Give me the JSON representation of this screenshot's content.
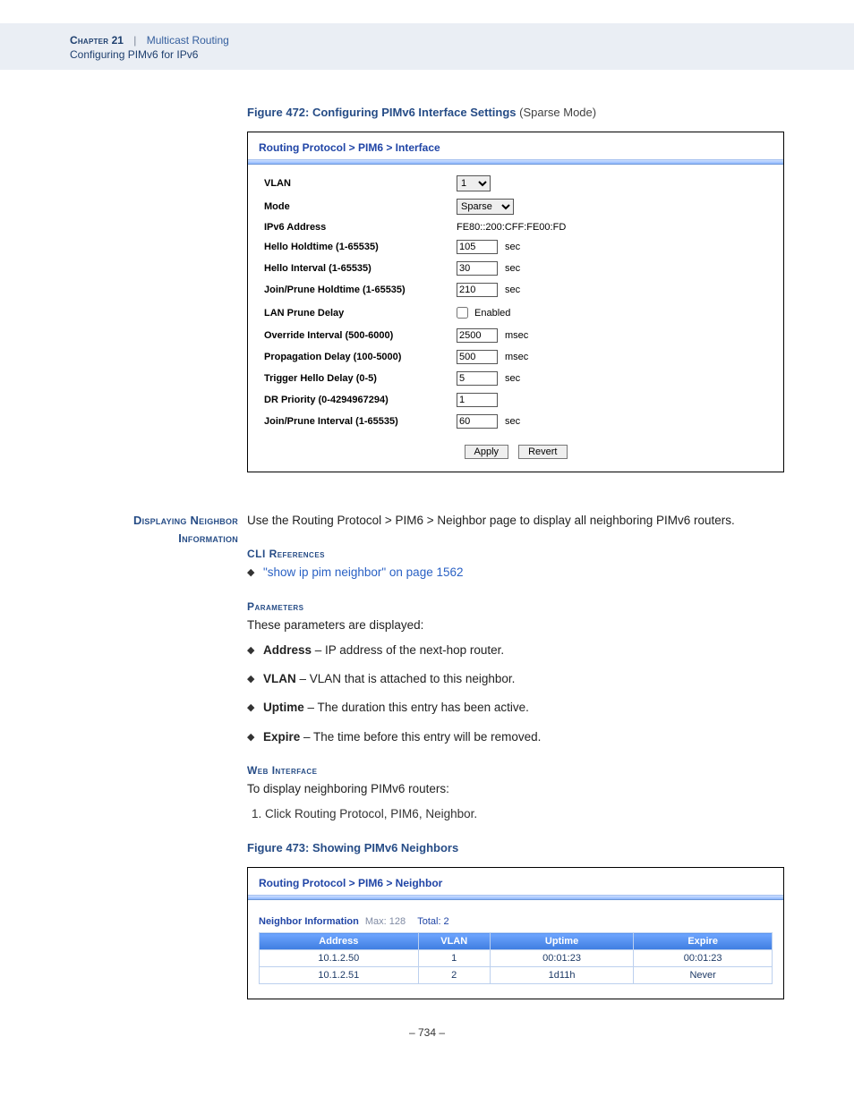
{
  "header": {
    "chapter_label": "Chapter",
    "chapter_num": "21",
    "separator": "|",
    "title": "Multicast Routing",
    "subtitle": "Configuring PIMv6 for IPv6"
  },
  "figure472": {
    "prefix": "Figure 472:  ",
    "title": "Configuring PIMv6 Interface Settings",
    "mode": " (Sparse Mode)",
    "breadcrumb": "Routing Protocol > PIM6 > Interface",
    "rows": {
      "vlan": {
        "label": "VLAN",
        "value": "1"
      },
      "mode": {
        "label": "Mode",
        "value": "Sparse"
      },
      "ipv6": {
        "label": "IPv6 Address",
        "value": "FE80::200:CFF:FE00:FD"
      },
      "hello_hold": {
        "label": "Hello Holdtime (1-65535)",
        "value": "105",
        "unit": "sec"
      },
      "hello_int": {
        "label": "Hello Interval (1-65535)",
        "value": "30",
        "unit": "sec"
      },
      "jp_hold": {
        "label": "Join/Prune Holdtime (1-65535)",
        "value": "210",
        "unit": "sec"
      },
      "lan_delay": {
        "label": "LAN Prune Delay",
        "text": "Enabled"
      },
      "override": {
        "label": "Override Interval (500-6000)",
        "value": "2500",
        "unit": "msec"
      },
      "prop": {
        "label": "Propagation Delay (100-5000)",
        "value": "500",
        "unit": "msec"
      },
      "trig": {
        "label": "Trigger Hello Delay (0-5)",
        "value": "5",
        "unit": "sec"
      },
      "dr": {
        "label": "DR Priority (0-4294967294)",
        "value": "1"
      },
      "jp_int": {
        "label": "Join/Prune Interval (1-65535)",
        "value": "60",
        "unit": "sec"
      }
    },
    "buttons": {
      "apply": "Apply",
      "revert": "Revert"
    }
  },
  "section": {
    "side_line1": "Displaying Neighbor",
    "side_line2": "Information",
    "intro": "Use the Routing Protocol > PIM6 > Neighbor page to display all neighboring PIMv6 routers.",
    "cli_head": "CLI References",
    "cli_link": "\"show ip pim neighbor\" on page 1562",
    "param_head": "Parameters",
    "param_intro": "These parameters are displayed:",
    "params": [
      {
        "name": "Address",
        "desc": " – IP address of the next-hop router."
      },
      {
        "name": "VLAN",
        "desc": " – VLAN that is attached to this neighbor."
      },
      {
        "name": "Uptime",
        "desc": " – The duration this entry has been active."
      },
      {
        "name": "Expire",
        "desc": " – The time before this entry will be removed."
      }
    ],
    "web_head": "Web Interface",
    "web_intro": "To display neighboring PIMv6 routers:",
    "step1": "Click Routing Protocol, PIM6, Neighbor."
  },
  "figure473": {
    "prefix": "Figure 473:  ",
    "title": "Showing PIMv6 Neighbors",
    "breadcrumb": "Routing Protocol > PIM6 > Neighbor",
    "info_label": "Neighbor Information",
    "info_max": "Max: 128",
    "info_total": "Total: 2",
    "columns": {
      "addr": "Address",
      "vlan": "VLAN",
      "uptime": "Uptime",
      "expire": "Expire"
    },
    "rows": [
      {
        "addr": "10.1.2.50",
        "vlan": "1",
        "uptime": "00:01:23",
        "expire": "00:01:23"
      },
      {
        "addr": "10.1.2.51",
        "vlan": "2",
        "uptime": "1d11h",
        "expire": "Never"
      }
    ]
  },
  "chart_data": {
    "type": "table",
    "title": "PIMv6 Neighbor Information",
    "columns": [
      "Address",
      "VLAN",
      "Uptime",
      "Expire"
    ],
    "rows": [
      [
        "10.1.2.50",
        "1",
        "00:01:23",
        "00:01:23"
      ],
      [
        "10.1.2.51",
        "2",
        "1d11h",
        "Never"
      ]
    ]
  },
  "page_number": "–  734  –"
}
